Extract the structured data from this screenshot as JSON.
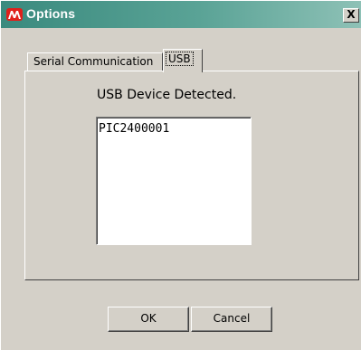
{
  "window": {
    "title": "Options",
    "close_label": "X",
    "icon": "microchip-logo-icon"
  },
  "tabs": [
    {
      "label": "Serial Communication",
      "selected": false
    },
    {
      "label": "USB",
      "selected": true
    }
  ],
  "usb": {
    "status_text": "USB Device Detected.",
    "devices": [
      "PIC2400001"
    ]
  },
  "buttons": {
    "ok_label": "OK",
    "cancel_label": "Cancel"
  },
  "colors": {
    "titlebar_start": "#3a8a7e",
    "titlebar_end": "#8ec1b6",
    "logo": "#e0201b",
    "face": "#d4d0c8"
  }
}
